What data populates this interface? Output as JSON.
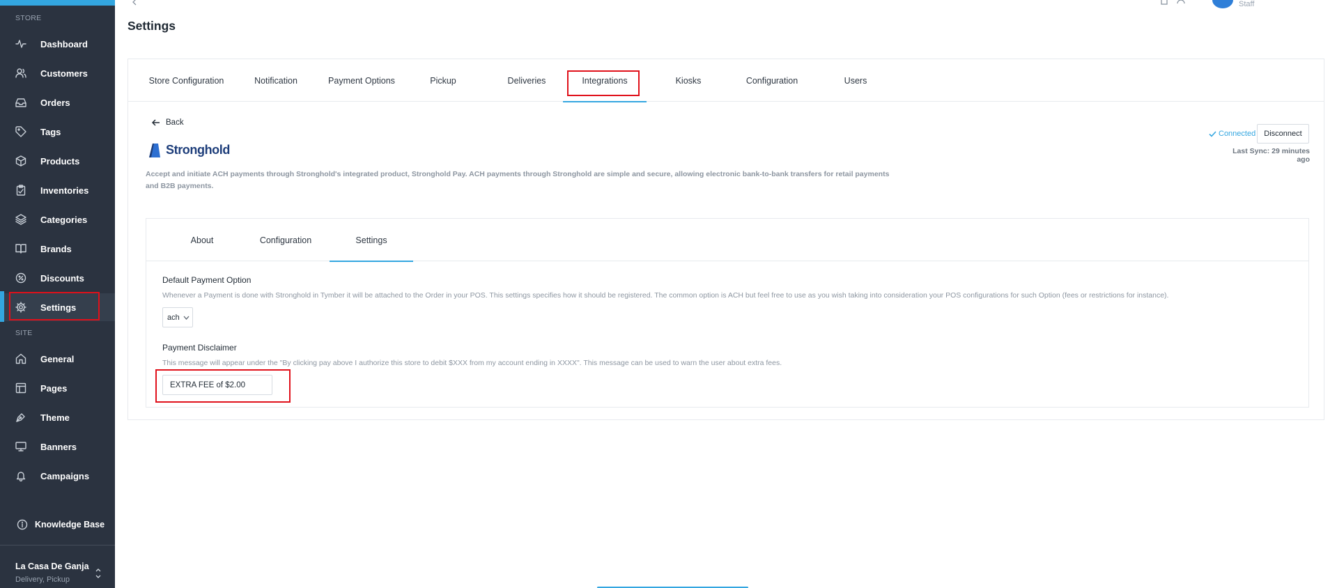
{
  "sidebar": {
    "store_label": "STORE",
    "site_label": "SITE",
    "store_items": [
      {
        "label": "Dashboard",
        "icon": "activity-icon"
      },
      {
        "label": "Customers",
        "icon": "users-icon"
      },
      {
        "label": "Orders",
        "icon": "inbox-icon"
      },
      {
        "label": "Tags",
        "icon": "tag-icon"
      },
      {
        "label": "Products",
        "icon": "box-icon"
      },
      {
        "label": "Inventories",
        "icon": "clipboard-icon"
      },
      {
        "label": "Categories",
        "icon": "layers-icon"
      },
      {
        "label": "Brands",
        "icon": "book-open-icon"
      },
      {
        "label": "Discounts",
        "icon": "discount-icon"
      },
      {
        "label": "Settings",
        "icon": "gear-icon"
      }
    ],
    "site_items": [
      {
        "label": "General",
        "icon": "home-icon"
      },
      {
        "label": "Pages",
        "icon": "layout-icon"
      },
      {
        "label": "Theme",
        "icon": "pen-tool-icon"
      },
      {
        "label": "Banners",
        "icon": "monitor-icon"
      },
      {
        "label": "Campaigns",
        "icon": "bell-icon"
      }
    ],
    "knowledge_base": "Knowledge Base",
    "store_name": "La Casa De Ganja",
    "store_sub": "Delivery, Pickup"
  },
  "header": {
    "title": "Settings",
    "role": "Staff"
  },
  "tabs": [
    "Store Configuration",
    "Notification",
    "Payment Options",
    "Pickup",
    "Deliveries",
    "Integrations",
    "Kiosks",
    "Configuration",
    "Users"
  ],
  "integration": {
    "back_label": "Back",
    "name": "Stronghold",
    "description": "Accept and initiate ACH payments through Stronghold's integrated product, Stronghold Pay. ACH payments through Stronghold are simple and secure, allowing electronic bank-to-bank transfers for retail payments and B2B payments.",
    "status": "Connected",
    "disconnect_label": "Disconnect",
    "last_sync": "Last Sync: 29 minutes ago"
  },
  "inner_tabs": [
    "About",
    "Configuration",
    "Settings"
  ],
  "settings": {
    "default_payment_label": "Default Payment Option",
    "default_payment_help": "Whenever a Payment is done with Stronghold in Tymber it will be attached to the Order in your POS. This settings specifies how it should be registered. The common option is ACH but feel free to use as you wish taking into consideration your POS configurations for such Option (fees or restrictions for instance).",
    "default_payment_value": "ach",
    "disclaimer_label": "Payment Disclaimer",
    "disclaimer_help": "This message will appear under the \"By clicking pay above I authorize this store to debit $XXX from my account ending in XXXX\". This message can be used to warn the user about extra fees.",
    "disclaimer_value": "EXTRA FEE of $2.00"
  },
  "colors": {
    "accent": "#33a6e0",
    "sidebar_bg": "#2b3340",
    "highlight": "#e0101a",
    "brand_navy": "#1d3d7a"
  }
}
